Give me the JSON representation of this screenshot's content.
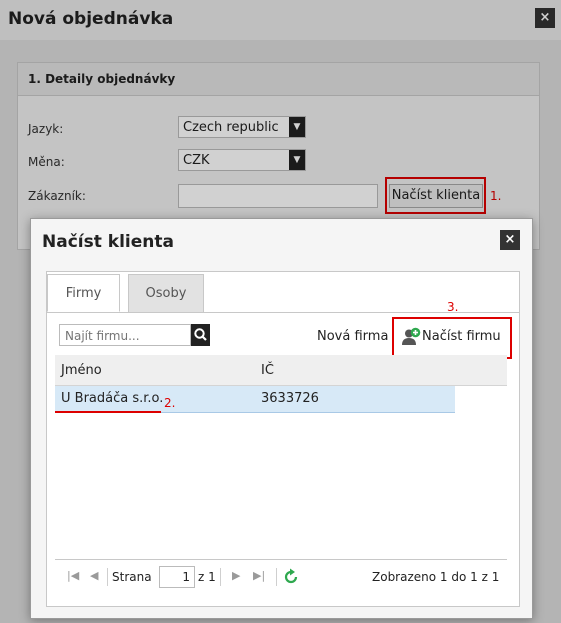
{
  "outer": {
    "title": "Nová objednávka",
    "close_label": "×",
    "section_title": "1. Detaily objednávky",
    "language_label": "Jazyk:",
    "language_value": "Czech republic",
    "currency_label": "Měna:",
    "currency_value": "CZK",
    "customer_label": "Zákazník:",
    "customer_value": "",
    "load_client_button": "Načíst klienta",
    "annotation_1": "1."
  },
  "modal": {
    "title": "Načíst klienta",
    "close_label": "×",
    "tabs": [
      {
        "label": "Firmy",
        "active": true
      },
      {
        "label": "Osoby",
        "active": false
      }
    ],
    "search_placeholder": "Najít firmu...",
    "new_company_link": "Nová firma",
    "load_company_button": "Načíst firmu",
    "annotation_3": "3.",
    "grid": {
      "columns": [
        "Jméno",
        "IČ"
      ],
      "rows": [
        {
          "name": "U Bradáča s.r.o.",
          "ic": "3633726",
          "selected": true
        }
      ]
    },
    "annotation_2": "2.",
    "pager": {
      "page_label": "Strana",
      "page_value": "1",
      "of_label": "z 1",
      "summary": "Zobrazeno 1 do 1 z 1"
    }
  },
  "colors": {
    "annotation_red": "#dd0000",
    "selected_row": "#d7e9f7",
    "add_icon_green": "#2fa84f"
  },
  "icons": [
    "close-icon",
    "dropdown-arrow-icon",
    "search-icon",
    "add-user-icon",
    "first-page-icon",
    "prev-page-icon",
    "next-page-icon",
    "last-page-icon",
    "refresh-icon"
  ]
}
